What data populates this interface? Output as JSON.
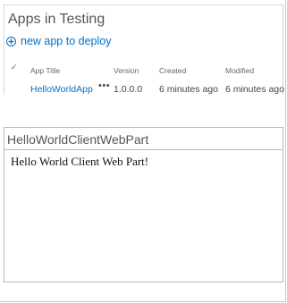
{
  "apps_panel": {
    "title": "Apps in Testing",
    "new_app_label": "new app to deploy",
    "columns": {
      "check": "✓",
      "app_title": "App Title",
      "version": "Version",
      "created": "Created",
      "modified": "Modified"
    },
    "rows": [
      {
        "app_title": "HelloWorldApp",
        "menu": "•••",
        "version": "1.0.0.0",
        "created": "6 minutes ago",
        "modified": "6 minutes ago"
      }
    ]
  },
  "web_part": {
    "title": "HelloWorldClientWebPart",
    "body": "Hello World Client Web Part!"
  },
  "colors": {
    "link": "#0072c6",
    "text": "#444444"
  }
}
